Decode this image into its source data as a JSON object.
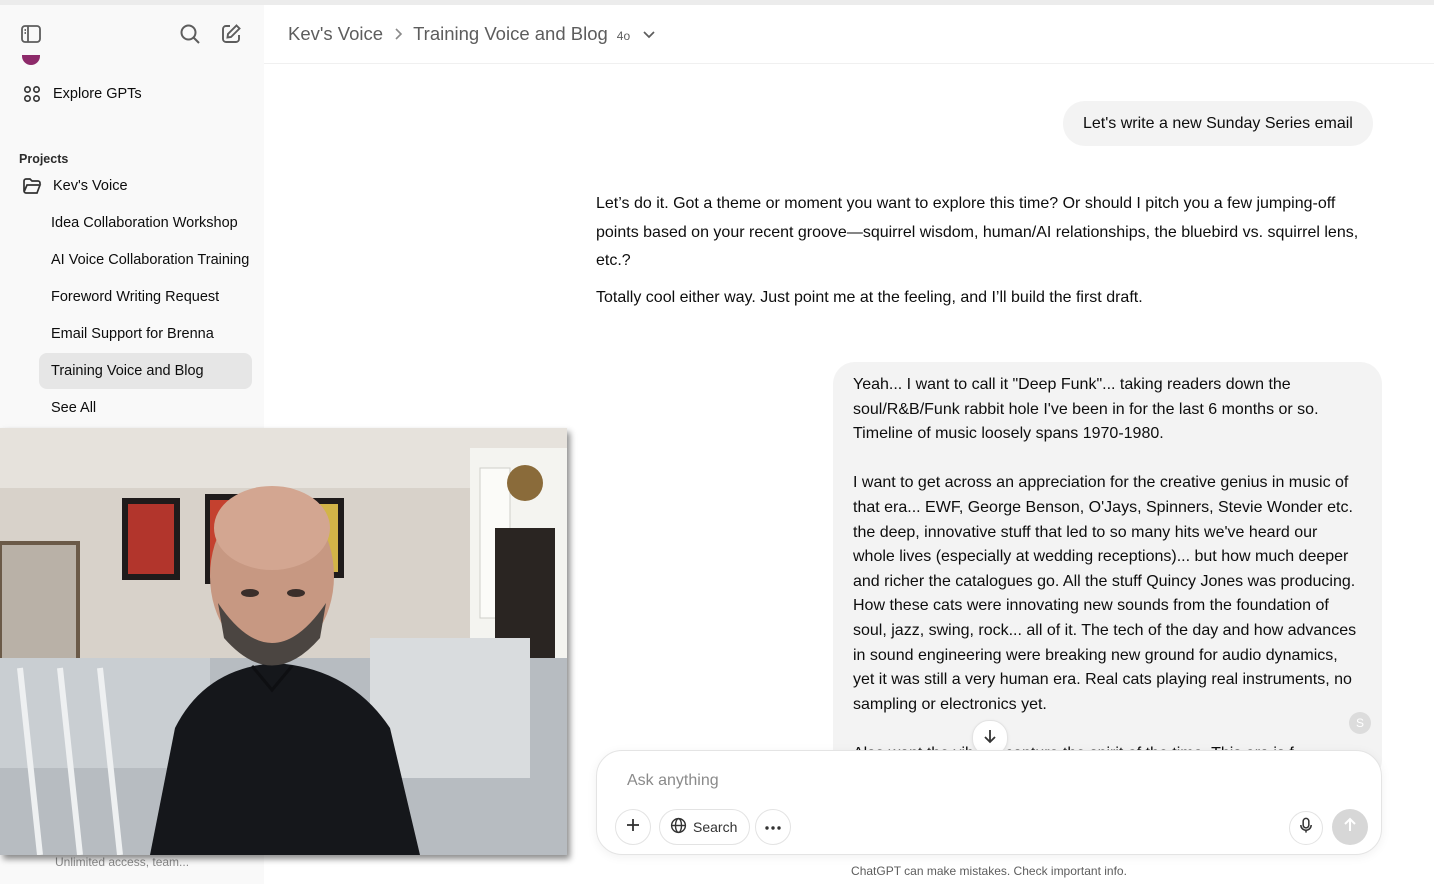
{
  "sidebar": {
    "explore_label": "Explore GPTs",
    "projects_heading": "Projects",
    "project_name": "Kev's Voice",
    "items": [
      {
        "label": "Idea Collaboration Workshop"
      },
      {
        "label": "AI Voice Collaboration Training"
      },
      {
        "label": "Foreword Writing Request"
      },
      {
        "label": "Email Support for Brenna"
      },
      {
        "label": "Training Voice and Blog"
      }
    ],
    "see_all": "See All",
    "bottom_text": "Unlimited access, team..."
  },
  "header": {
    "project": "Kev's Voice",
    "chat": "Training Voice and Blog",
    "model": "4o"
  },
  "messages": {
    "user_1": "Let's write a new Sunday Series email",
    "assistant_1_p1": "Let’s do it. Got a theme or moment you want to explore this time? Or should I pitch you a few jumping-off points based on your recent groove—squirrel wisdom, human/AI relationships, the bluebird vs. squirrel lens, etc.?",
    "assistant_1_p2": "Totally cool either way. Just point me at the feeling, and I’ll build the first draft.",
    "user_2_p1": "Yeah... I want to call it \"Deep Funk\"... taking readers down the soul/R&B/Funk rabbit hole I've been in for the last 6 months or so. Timeline of music loosely spans 1970-1980.",
    "user_2_p2": "I want to get across an appreciation for the creative genius in music of that era... EWF, George Benson, O'Jays, Spinners, Stevie Wonder etc. the deep, innovative stuff that led to so many hits we've heard our whole lives (especially at wedding receptions)... but how much deeper and richer the catalogues go. All the stuff Quincy Jones was producing. How these cats were innovating new sounds from the foundation of soul, jazz, swing, rock... all of it. The tech of the day and how advances in sound engineering were breaking new ground for audio dynamics, yet it was still a very human era. Real cats playing real instruments, no sampling or electronics yet.",
    "user_2_p3": "Also want the vibe to capture the spirit of the time. This era is f",
    "badge_letter": "S"
  },
  "composer": {
    "placeholder": "Ask anything",
    "search_label": "Search"
  },
  "disclaimer": "ChatGPT can make mistakes. Check important info.",
  "icons": {
    "sidebar_toggle": "sidebar-toggle-icon",
    "search": "search-icon",
    "new_chat": "new-chat-icon",
    "explore": "grid-icon",
    "folder": "folder-icon"
  }
}
